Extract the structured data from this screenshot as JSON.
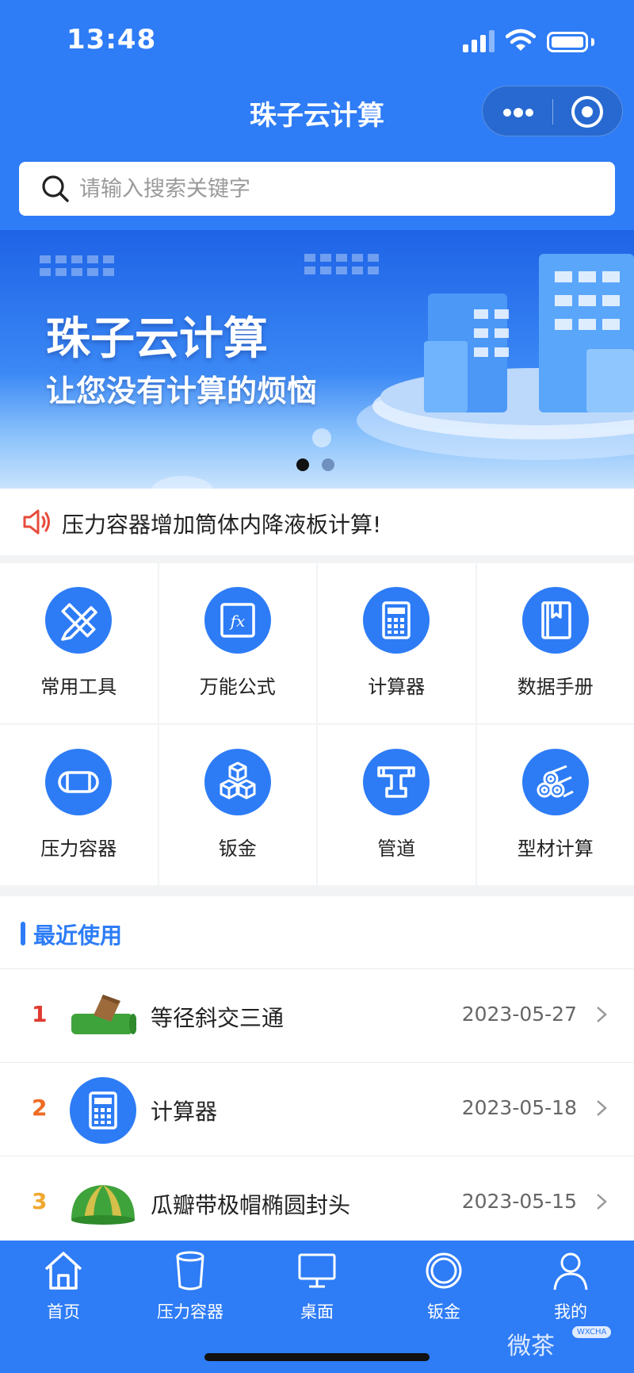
{
  "status_bar": {
    "time": "13:48"
  },
  "nav": {
    "title": "珠子云计算"
  },
  "search": {
    "placeholder": "请输入搜索关键字"
  },
  "banner": {
    "title": "珠子云计算",
    "subtitle": "让您没有计算的烦恼",
    "active_slide": 1,
    "slide_count": 2
  },
  "notice": {
    "text": "压力容器增加筒体内降液板计算!"
  },
  "grid": [
    {
      "label": "常用工具",
      "icon": "ruler-pencil-icon"
    },
    {
      "label": "万能公式",
      "icon": "formula-icon"
    },
    {
      "label": "计算器",
      "icon": "calculator-icon"
    },
    {
      "label": "数据手册",
      "icon": "book-icon"
    },
    {
      "label": "压力容器",
      "icon": "vessel-icon"
    },
    {
      "label": "钣金",
      "icon": "cubes-icon"
    },
    {
      "label": "管道",
      "icon": "pipe-icon"
    },
    {
      "label": "型材计算",
      "icon": "profile-bars-icon"
    }
  ],
  "recent": {
    "title": "最近使用",
    "items": [
      {
        "rank": "1",
        "name": "等径斜交三通",
        "date": "2023-05-27",
        "rank_color": "#e03a2f",
        "thumb": "tee-pipe-icon"
      },
      {
        "rank": "2",
        "name": "计算器",
        "date": "2023-05-18",
        "rank_color": "#ef6b24",
        "thumb": "calculator-icon"
      },
      {
        "rank": "3",
        "name": "瓜瓣带极帽椭圆封头",
        "date": "2023-05-15",
        "rank_color": "#f0a830",
        "thumb": "dome-head-icon"
      }
    ]
  },
  "tabbar": [
    {
      "label": "首页",
      "icon": "home-icon"
    },
    {
      "label": "压力容器",
      "icon": "bucket-icon"
    },
    {
      "label": "桌面",
      "icon": "monitor-icon"
    },
    {
      "label": "钣金",
      "icon": "ring-icon"
    },
    {
      "label": "我的",
      "icon": "user-icon"
    }
  ],
  "watermark": {
    "text": "微茶",
    "tag": "WXCHA"
  },
  "colors": {
    "primary": "#2e7cf6",
    "icon_blue": "#2d7cf6",
    "page_bg": "#f2f3f5"
  }
}
